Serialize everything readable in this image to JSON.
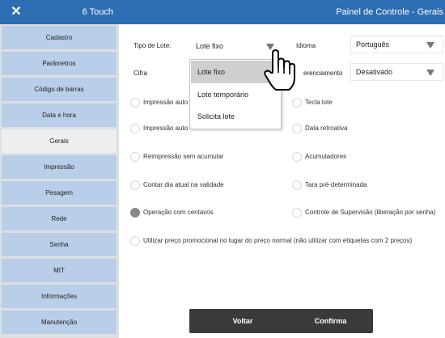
{
  "titlebar": {
    "app_name": "6 Touch",
    "panel_title": "Painel de Controle - Gerais",
    "close_glyph": "✕"
  },
  "sidebar": {
    "items": [
      {
        "label": "Cadastro"
      },
      {
        "label": "Parâmetros"
      },
      {
        "label": "Código de barras"
      },
      {
        "label": "Data e hora"
      },
      {
        "label": "Gerais"
      },
      {
        "label": "Impressão"
      },
      {
        "label": "Pesagem"
      },
      {
        "label": "Rede"
      },
      {
        "label": "Senha"
      },
      {
        "label": "MIT"
      },
      {
        "label": "Informações"
      },
      {
        "label": "Manutenção"
      }
    ],
    "active": "Gerais"
  },
  "form": {
    "tipo_lote_label": "Tipo de Lote:",
    "tipo_lote_value": "Lote fixo",
    "idioma_label": "Idioma",
    "idioma_value": "Português",
    "cifra_label": "Cifra",
    "gerenciamento_label": "erenciamento",
    "gerenciamento_value": "Desativado"
  },
  "dropdown": {
    "options": [
      "Lote fixo",
      "Lote temporário",
      "Solicita lote"
    ],
    "highlighted": "Lote fixo"
  },
  "options_left": [
    {
      "label": "Impressão auto",
      "checked": false
    },
    {
      "label": "Impressão auto",
      "checked": false
    },
    {
      "label": "Reimpressão sem acumular",
      "checked": false
    },
    {
      "label": "Contar dia atual na validade",
      "checked": false
    },
    {
      "label": "Operação com centavos",
      "checked": true
    },
    {
      "label": "Utilizar preço promocional no lugar do preço normal (não utilizar com etiquetas com 2 preços)",
      "checked": false
    }
  ],
  "options_right": [
    {
      "label": "Tecla lote",
      "checked": false
    },
    {
      "label": "Data retroativa",
      "checked": false
    },
    {
      "label": "Acumuladores",
      "checked": false
    },
    {
      "label": "Tara pré-determinada",
      "checked": false
    },
    {
      "label": "Controle de Supervisão (liberação por senha)",
      "checked": false
    }
  ],
  "buttons": {
    "back": "Voltar",
    "confirm": "Confirma"
  },
  "colors": {
    "titlebar": "#2d6db3",
    "sidebar_item": "#b9cee8",
    "sidebar_active": "#eceef0",
    "button": "#3a3a3a"
  }
}
